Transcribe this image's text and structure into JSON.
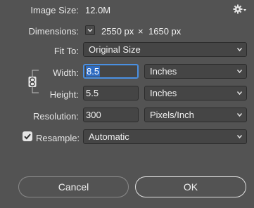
{
  "image_size": {
    "label": "Image Size:",
    "value": "12.0M"
  },
  "gear_menu": {
    "icon": "gear-icon"
  },
  "dimensions": {
    "label": "Dimensions:",
    "width": "2550 px",
    "times": "×",
    "height": "1650 px"
  },
  "fit_to": {
    "label": "Fit To:",
    "value": "Original Size"
  },
  "width": {
    "label": "Width:",
    "value": "8.5",
    "unit": "Inches"
  },
  "height": {
    "label": "Height:",
    "value": "5.5",
    "unit": "Inches"
  },
  "resolution": {
    "label": "Resolution:",
    "value": "300",
    "unit": "Pixels/Inch"
  },
  "resample": {
    "label": "Resample:",
    "checked": true,
    "value": "Automatic"
  },
  "buttons": {
    "cancel": "Cancel",
    "ok": "OK"
  }
}
